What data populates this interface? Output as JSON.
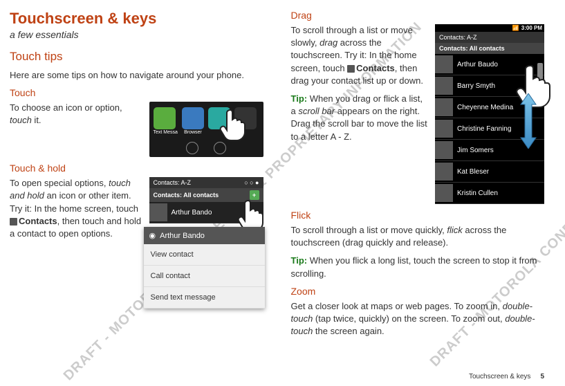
{
  "watermark": "DRAFT - MOTOROLA CONFIDENTIAL & PROPRIETARY INFORMATION",
  "col1": {
    "title": "Touchscreen & keys",
    "subtitle": "a few essentials",
    "section_tips": "Touch tips",
    "tips_intro": "Here are some tips on how to navigate around your phone.",
    "touch_h": "Touch",
    "touch_p_a": "To choose an icon or option, ",
    "touch_p_em": "touch",
    "touch_p_b": " it.",
    "touch_app1": "Text Messa",
    "touch_app2": "Browser",
    "touchhold_h": "Touch & hold",
    "touchhold_p_a": "To open special options, ",
    "touchhold_p_em": "touch and hold",
    "touchhold_p_b": " an icon or other item. Try it: In the home screen, touch ",
    "touchhold_contacts": "Contacts",
    "touchhold_p_c": ", then touch and hold a contact to open options.",
    "ss2_header1": "Contacts: A-Z",
    "ss2_header2": "Contacts: All contacts",
    "ss2_contact1": "Arthur Bando",
    "ss2_popup_title": "Arthur Bando",
    "ss2_opt1": "View contact",
    "ss2_opt2": "Call contact",
    "ss2_opt3": "Send text message"
  },
  "col2": {
    "drag_h": "Drag",
    "drag_p_a": "To scroll through a list or move slowly, ",
    "drag_p_em": "drag",
    "drag_p_b": " across the touchscreen. Try it: In the home screen, touch ",
    "drag_contacts": "Contacts",
    "drag_p_c": ", then drag your contact list up or down.",
    "drag_tip_a": "When you drag or flick a list, a ",
    "drag_tip_em": "scroll bar",
    "drag_tip_b": " appears on the right. Drag the scroll bar to move the list to a letter A - Z.",
    "flick_h": "Flick",
    "flick_p_a": "To scroll through a list or move quickly, ",
    "flick_p_em": "flick",
    "flick_p_b": " across the touchscreen (drag quickly and release).",
    "flick_tip": "When you flick a long list, touch the screen to stop it from scrolling.",
    "zoom_h": "Zoom",
    "zoom_p_a": "Get a closer look at maps or web pages. To zoom in, ",
    "zoom_p_em1": "double-touch",
    "zoom_p_b": " (tap twice, quickly) on the screen. To zoom out, ",
    "zoom_p_em2": "double-touch",
    "zoom_p_c": " the screen again.",
    "ss3_time": "3:00 PM",
    "ss3_header1": "Contacts: A-Z",
    "ss3_header2": "Contacts: All contacts",
    "ss3_contacts": [
      "Arthur Baudo",
      "Barry Smyth",
      "Cheyenne Medina",
      "Christine Fanning",
      "Jim Somers",
      "Kat Bleser",
      "Kristin Cullen"
    ]
  },
  "tip_label": "Tip: ",
  "footer_text": "Touchscreen & keys",
  "page_number": "5"
}
